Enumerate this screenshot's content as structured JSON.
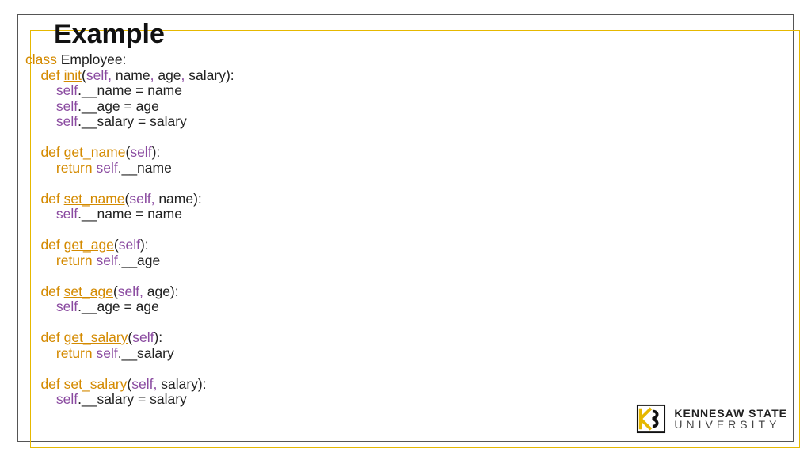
{
  "title": "Example",
  "colors": {
    "keyword": "#d48a00",
    "self": "#8a4aa0",
    "frame_outer": "#555555",
    "frame_inner": "#e6b800"
  },
  "code": {
    "class_kw": "class",
    "class_name": " Employee:",
    "def_kw": "def",
    "return_kw": "return",
    "self_kw": "self",
    "comma": ",",
    "init_fn": "init",
    "init_params": " name",
    "init_p2": " age",
    "init_p3": " salary):",
    "line_name": ".__name = name",
    "line_age": ".__age = age",
    "line_salary": ".__salary = salary",
    "get_name_fn": "get_name",
    "paren_self_close": "):",
    "ret_name": ".__name",
    "set_name_fn": "set_name",
    "set_name_params": " name):",
    "set_name_body": ".__name = name",
    "get_age_fn": "get_age",
    "ret_age": ".__age",
    "set_age_fn": "set_age",
    "set_age_params": " age):",
    "set_age_body": ".__age = age",
    "get_salary_fn": "get_salary",
    "ret_salary": ".__salary",
    "set_salary_fn": "set_salary",
    "set_salary_params": " salary):",
    "set_salary_body": ".__salary = salary",
    "open_paren": "("
  },
  "logo": {
    "line1": "KENNESAW STATE",
    "line2": "UNIVERSITY"
  }
}
